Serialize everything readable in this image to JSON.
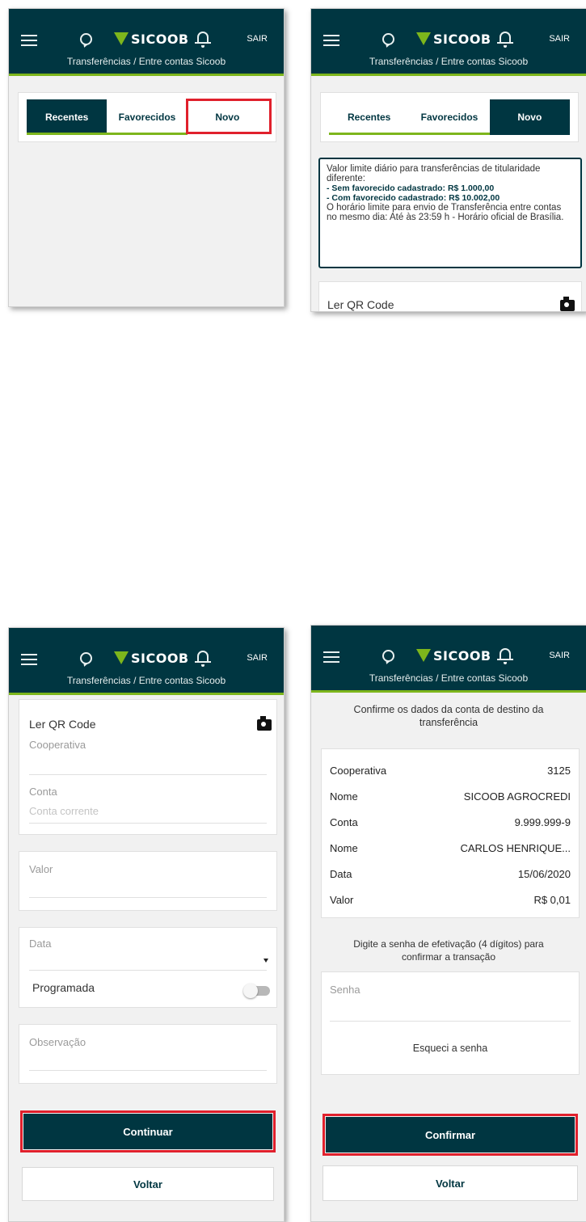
{
  "header": {
    "brand": "SICOOB",
    "logout_label": "SAIR",
    "breadcrumb": "Transferências / Entre contas Sicoob",
    "icons": [
      "menu-icon",
      "chat-icon",
      "sicoob-logo",
      "bell-icon"
    ]
  },
  "tabs": {
    "recent": "Recentes",
    "favorites": "Favorecidos",
    "new": "Novo"
  },
  "info_box": {
    "line1": "Valor limite diário para transferências de titularidade diferente:",
    "limit_without": "- Sem favorecido cadastrado: R$ 1.000,00",
    "limit_with": "- Com favorecido cadastrado: R$ 10.002,00",
    "line2": "O horário limite para envio de Transferência entre contas no mesmo dia: Até às 23:59 h - Horário oficial de Brasília."
  },
  "form": {
    "qr_label": "Ler QR Code",
    "cooperativa_placeholder": "Cooperativa",
    "conta_label": "Conta",
    "conta_placeholder": "Conta corrente",
    "valor_placeholder": "Valor",
    "data_placeholder": "Data",
    "programada_label": "Programada",
    "observacao_placeholder": "Observação",
    "continue_button": "Continuar",
    "back_button": "Voltar"
  },
  "confirm": {
    "heading": "Confirme os dados da conta de destino da transferência",
    "rows": [
      {
        "label": "Cooperativa",
        "value": "3125"
      },
      {
        "label": "Nome",
        "value": "SICOOB AGROCREDI"
      },
      {
        "label": "Conta",
        "value": "9.999.999-9"
      },
      {
        "label": "Nome",
        "value": "CARLOS HENRIQUE..."
      },
      {
        "label": "Data",
        "value": "15/06/2020"
      },
      {
        "label": "Valor",
        "value": "R$ 0,01"
      }
    ],
    "password_prompt": "Digite a senha de efetivação (4 dígitos) para confirmar a transação",
    "password_placeholder": "Senha",
    "forgot_password": "Esqueci a senha",
    "confirm_button": "Confirmar",
    "back_button": "Voltar"
  },
  "colors": {
    "brand_dark": "#003641",
    "brand_green": "#7db61c",
    "highlight_red": "#e0202c"
  }
}
